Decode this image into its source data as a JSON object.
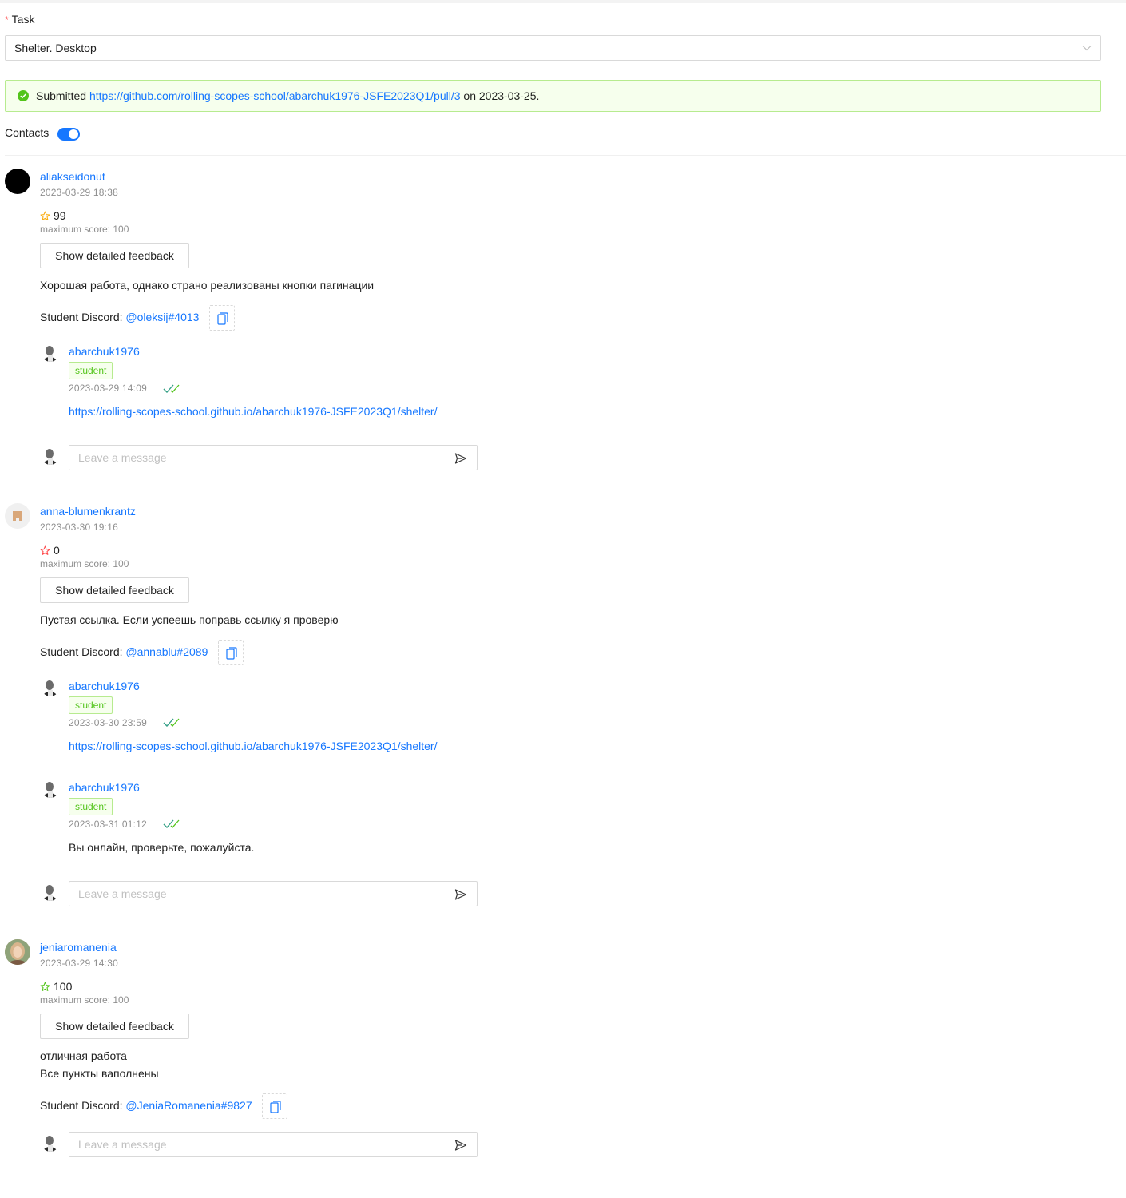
{
  "task": {
    "label": "Task",
    "required_mark": "*",
    "selected": "Shelter. Desktop"
  },
  "submission": {
    "prefix": "Submitted",
    "url": "https://github.com/rolling-scopes-school/abarchuk1976-JSFE2023Q1/pull/3",
    "middle": "on",
    "date": "2023-03-25."
  },
  "contacts": {
    "label": "Contacts",
    "enabled": true
  },
  "colors": {
    "link": "#1677ff",
    "success": "#52c41a",
    "success_bg": "#f6ffed",
    "error_star": "#ff4d4f",
    "warning_star": "#faad14"
  },
  "reviews": [
    {
      "reviewer": "aliakseidonut",
      "date": "2023-03-29 18:38",
      "score": "99",
      "star_color": "#faad14",
      "max_score": "maximum score: 100",
      "feedback_button": "Show detailed feedback",
      "comment": "Хорошая работа, однако страно реализованы кнопки пагинации",
      "discord_label": "Student Discord:",
      "discord": "@oleksij#4013",
      "replies": [
        {
          "user": "abarchuk1976",
          "tag": "student",
          "date": "2023-03-29 14:09",
          "message": "https://rolling-scopes-school.github.io/abarchuk1976-JSFE2023Q1/shelter/"
        }
      ],
      "input_placeholder": "Leave a message"
    },
    {
      "reviewer": "anna-blumenkrantz",
      "date": "2023-03-30 19:16",
      "score": "0",
      "star_color": "#ff4d4f",
      "max_score": "maximum score: 100",
      "feedback_button": "Show detailed feedback",
      "comment": "Пустая ссылка. Если успеешь поправь ссылку я проверю",
      "discord_label": "Student Discord:",
      "discord": "@annablu#2089",
      "replies": [
        {
          "user": "abarchuk1976",
          "tag": "student",
          "date": "2023-03-30 23:59",
          "message": "https://rolling-scopes-school.github.io/abarchuk1976-JSFE2023Q1/shelter/"
        },
        {
          "user": "abarchuk1976",
          "tag": "student",
          "date": "2023-03-31 01:12",
          "message": "Вы онлайн, проверьте, пожалуйста."
        }
      ],
      "input_placeholder": "Leave a message"
    },
    {
      "reviewer": "jeniaromanenia",
      "date": "2023-03-29 14:30",
      "score": "100",
      "star_color": "#52c41a",
      "max_score": "maximum score: 100",
      "feedback_button": "Show detailed feedback",
      "comment": "отличная работа\nВсе пункты ваполнены",
      "discord_label": "Student Discord:",
      "discord": "@JeniaRomanenia#9827",
      "replies": [],
      "input_placeholder": "Leave a message"
    }
  ]
}
